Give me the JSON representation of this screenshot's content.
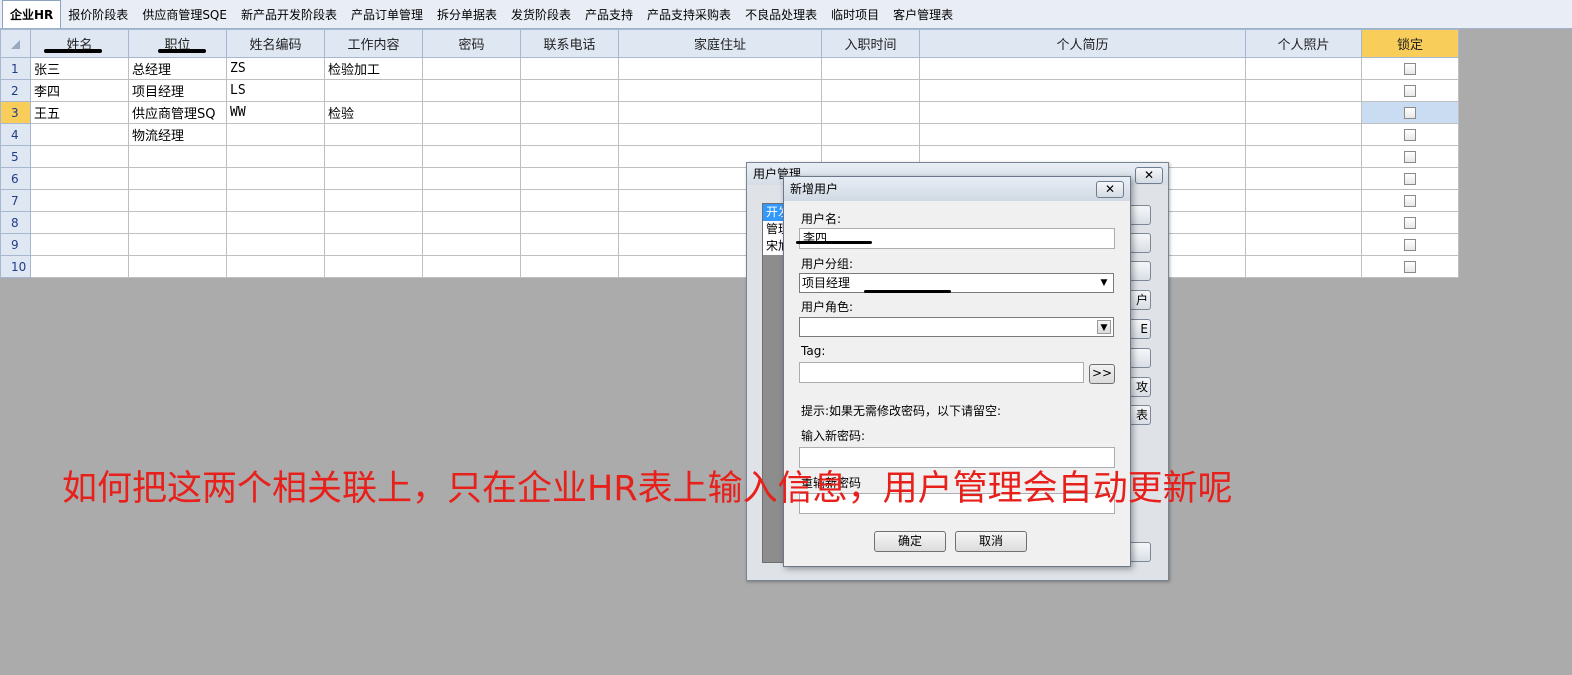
{
  "tabs": [
    "企业HR",
    "报价阶段表",
    "供应商管理SQE",
    "新产品开发阶段表",
    "产品订单管理",
    "拆分单据表",
    "发货阶段表",
    "产品支持",
    "产品支持采购表",
    "不良品处理表",
    "临时项目",
    "客户管理表"
  ],
  "active_tab": "企业HR",
  "sheet": {
    "headers": [
      "姓名",
      "职位",
      "姓名编码",
      "工作内容",
      "密码",
      "联系电话",
      "家庭住址",
      "入职时间",
      "个人简历",
      "个人照片",
      "锁定"
    ],
    "rows": [
      {
        "num": "1",
        "cells": [
          "张三",
          "总经理",
          "ZS",
          "检验加工",
          "",
          "",
          "",
          "",
          "",
          ""
        ]
      },
      {
        "num": "2",
        "cells": [
          "李四",
          "项目经理",
          "LS",
          "",
          "",
          "",
          "",
          "",
          "",
          ""
        ]
      },
      {
        "num": "3",
        "cells": [
          "王五",
          "供应商管理SQ",
          "WW",
          "检验",
          "",
          "",
          "",
          "",
          "",
          ""
        ]
      },
      {
        "num": "4",
        "cells": [
          "",
          "物流经理",
          "",
          "",
          "",
          "",
          "",
          "",
          "",
          ""
        ]
      },
      {
        "num": "5",
        "cells": [
          "",
          "",
          "",
          "",
          "",
          "",
          "",
          "",
          "",
          ""
        ]
      },
      {
        "num": "6",
        "cells": [
          "",
          "",
          "",
          "",
          "",
          "",
          "",
          "",
          "",
          ""
        ]
      },
      {
        "num": "7",
        "cells": [
          "",
          "",
          "",
          "",
          "",
          "",
          "",
          "",
          "",
          ""
        ]
      },
      {
        "num": "8",
        "cells": [
          "",
          "",
          "",
          "",
          "",
          "",
          "",
          "",
          "",
          ""
        ]
      },
      {
        "num": "9",
        "cells": [
          "",
          "",
          "",
          "",
          "",
          "",
          "",
          "",
          "",
          ""
        ]
      },
      {
        "num": "10",
        "cells": [
          "",
          "",
          "",
          "",
          "",
          "",
          "",
          "",
          "",
          ""
        ]
      }
    ],
    "selected_row": "3"
  },
  "user_mgmt_dialog": {
    "title": "用户管理",
    "list_items": [
      "开发",
      "管理",
      "宋旭"
    ],
    "button_fragments": [
      "",
      "",
      "",
      "户",
      "E",
      "",
      "攻",
      "表",
      ""
    ]
  },
  "new_user_dialog": {
    "title": "新增用户",
    "username_label": "用户名:",
    "username_value": "李四",
    "group_label": "用户分组:",
    "group_value": "项目经理",
    "role_label": "用户角色:",
    "role_value": "",
    "tag_label": "Tag:",
    "tag_value": "",
    "tag_button": ">>",
    "hint": "提示:如果无需修改密码，以下请留空:",
    "new_password_label": "输入新密码:",
    "confirm_password_label": "重输新密码",
    "ok_label": "确定",
    "cancel_label": "取消"
  },
  "overlay_question": "如何把这两个相关联上，只在企业HR表上输入信息，用户管理会自动更新呢",
  "colors": {
    "lock_header": "#f8cd59",
    "overlay_text": "#e8201b",
    "selection": "#3399ff"
  }
}
